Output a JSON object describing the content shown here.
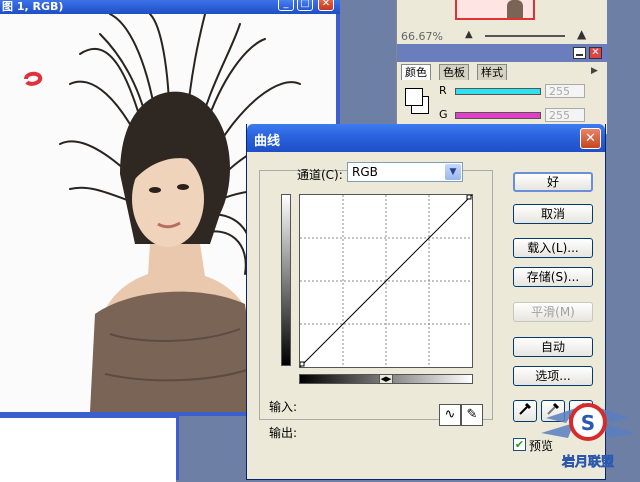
{
  "document_window": {
    "title": "图 1, RGB)",
    "buttons": {
      "minimize": "_",
      "maximize": "□",
      "close": "✕"
    }
  },
  "navigator_panel": {
    "zoom": "66.67%"
  },
  "color_panel": {
    "tabs": [
      "颜色",
      "色板",
      "样式"
    ],
    "channels": [
      {
        "label": "R",
        "value": "255",
        "color": "#2fe0ef"
      },
      {
        "label": "G",
        "value": "255",
        "color": "#e040c8"
      }
    ]
  },
  "curves_dialog": {
    "title": "曲线",
    "channel_label": "通道(C):",
    "channel_value": "RGB",
    "input_label": "输入:",
    "output_label": "输出:",
    "buttons": {
      "ok": "好",
      "cancel": "取消",
      "load": "载入(L)...",
      "save": "存储(S)...",
      "smooth": "平滑(M)",
      "auto": "自动",
      "options": "选项..."
    },
    "preview_label": "预览",
    "preview_checked": true,
    "curve_points": [
      [
        0,
        0
      ],
      [
        255,
        255
      ]
    ]
  },
  "watermark": {
    "text": "岩月联盟"
  }
}
